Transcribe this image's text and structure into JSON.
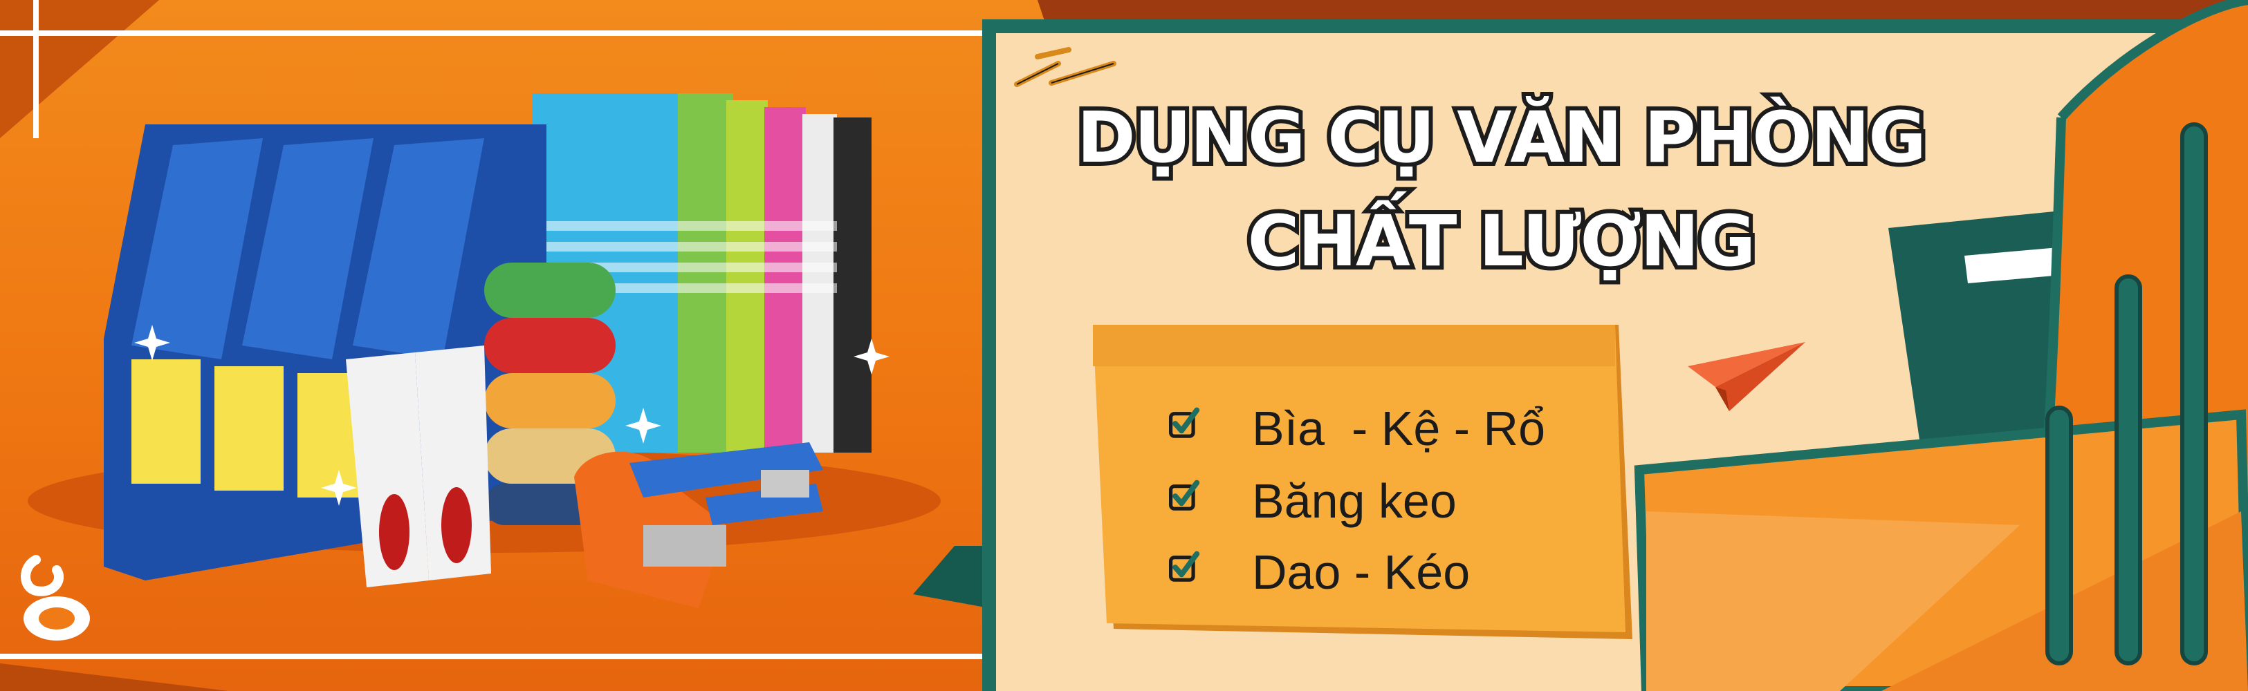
{
  "banner": {
    "title_line1": "DỤNG CỤ VĂN PHÒNG",
    "title_line2": "CHẤT LƯỢNG",
    "checklist": [
      {
        "label": "Bìa  - Kệ - Rổ"
      },
      {
        "label": "Băng keo"
      },
      {
        "label": "Dao - Kéo"
      }
    ]
  },
  "colors": {
    "orange_bg": "#f07a16",
    "cream_panel": "#fbdcaf",
    "sticky_note": "#f8ad3a",
    "teal_accent": "#1f6e62",
    "title_fill": "#ffffff",
    "title_stroke": "#1c1c1c"
  },
  "icons": [
    "logo-icon",
    "checkbox-check-icon",
    "paper-plane-icon",
    "staple-icon"
  ]
}
